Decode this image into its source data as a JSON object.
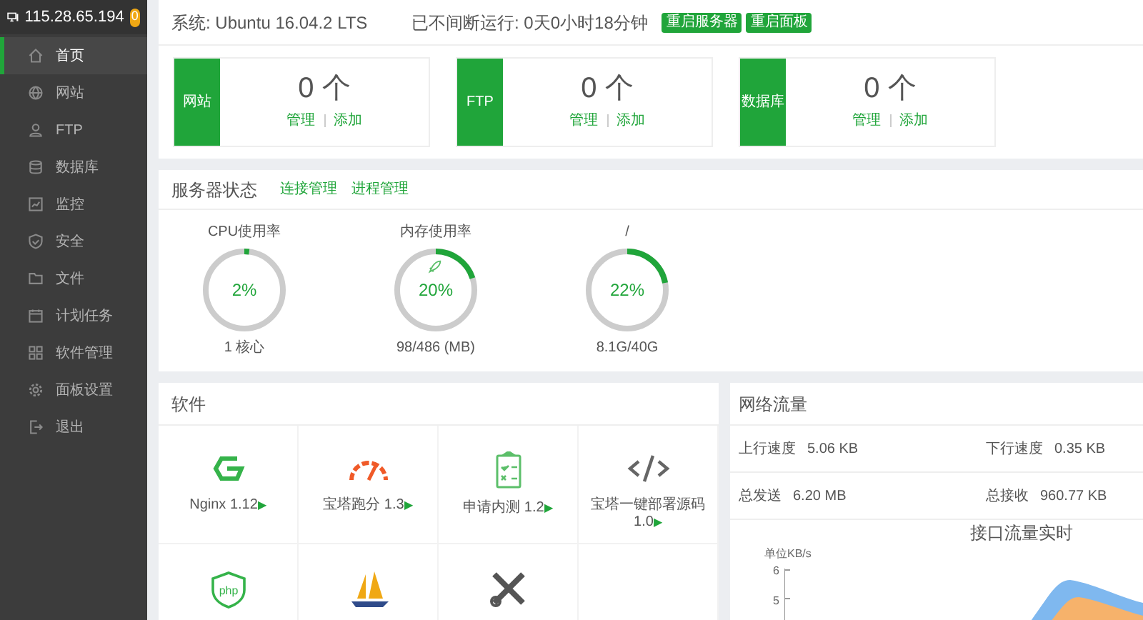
{
  "sidebar": {
    "host": "115.28.65.194",
    "badge": "0",
    "items": [
      {
        "label": "首页",
        "kind": "home",
        "selected": true
      },
      {
        "label": "网站",
        "kind": "globe",
        "selected": false
      },
      {
        "label": "FTP",
        "kind": "user",
        "selected": false
      },
      {
        "label": "数据库",
        "kind": "database",
        "selected": false
      },
      {
        "label": "监控",
        "kind": "monitor",
        "selected": false
      },
      {
        "label": "安全",
        "kind": "shield",
        "selected": false
      },
      {
        "label": "文件",
        "kind": "folder",
        "selected": false
      },
      {
        "label": "计划任务",
        "kind": "calendar",
        "selected": false
      },
      {
        "label": "软件管理",
        "kind": "grid",
        "selected": false
      },
      {
        "label": "面板设置",
        "kind": "gear",
        "selected": false
      },
      {
        "label": "退出",
        "kind": "exit",
        "selected": false
      }
    ]
  },
  "header": {
    "system": "系统: Ubuntu 16.04.2 LTS",
    "uptime": "已不间断运行: 0天0小时18分钟",
    "buttons": [
      "重启服务器",
      "重启面板"
    ]
  },
  "stat_cards": [
    {
      "label": "网站",
      "count": "0 个",
      "links": [
        "管理",
        "添加"
      ]
    },
    {
      "label": "FTP",
      "count": "0 个",
      "links": [
        "管理",
        "添加"
      ]
    },
    {
      "label": "数据库",
      "count": "0 个",
      "links": [
        "管理",
        "添加"
      ]
    }
  ],
  "server_status": {
    "title": "服务器状态",
    "links": [
      "连接管理",
      "进程管理"
    ],
    "gauges": [
      {
        "label": "CPU使用率",
        "percent": "2%",
        "level": 0.02,
        "detail": "1 核心",
        "boost": false
      },
      {
        "label": "内存使用率",
        "percent": "20%",
        "level": 0.2,
        "detail": "98/486 (MB)",
        "boost": true
      },
      {
        "label": "/",
        "percent": "22%",
        "level": 0.22,
        "detail": "8.1G/40G",
        "boost": false
      }
    ]
  },
  "software": {
    "title": "软件",
    "items": [
      {
        "kind": "nginx",
        "name": "Nginx 1.12",
        "arrow": "▶"
      },
      {
        "kind": "gauge",
        "name": "宝塔跑分 1.3",
        "arrow": "▶"
      },
      {
        "kind": "clipboard",
        "name": "申请内测 1.2",
        "arrow": "▶"
      },
      {
        "kind": "code",
        "name": "宝塔一键部署源码 1.0",
        "arrow": "▶"
      },
      {
        "kind": "php"
      },
      {
        "kind": "boat"
      },
      {
        "kind": "tools"
      },
      {
        "kind": "empty"
      }
    ]
  },
  "network": {
    "title": "网络流量",
    "stats": [
      {
        "label": "上行速度",
        "value": "5.06 KB"
      },
      {
        "label": "下行速度",
        "value": "0.35 KB"
      },
      {
        "label": "总发送",
        "value": "6.20 MB"
      },
      {
        "label": "总接收",
        "value": "960.77 KB"
      }
    ],
    "chart": {
      "title": "接口流量实时",
      "unit": "单位KB/s",
      "yticks": [
        "6",
        "5"
      ]
    }
  }
}
